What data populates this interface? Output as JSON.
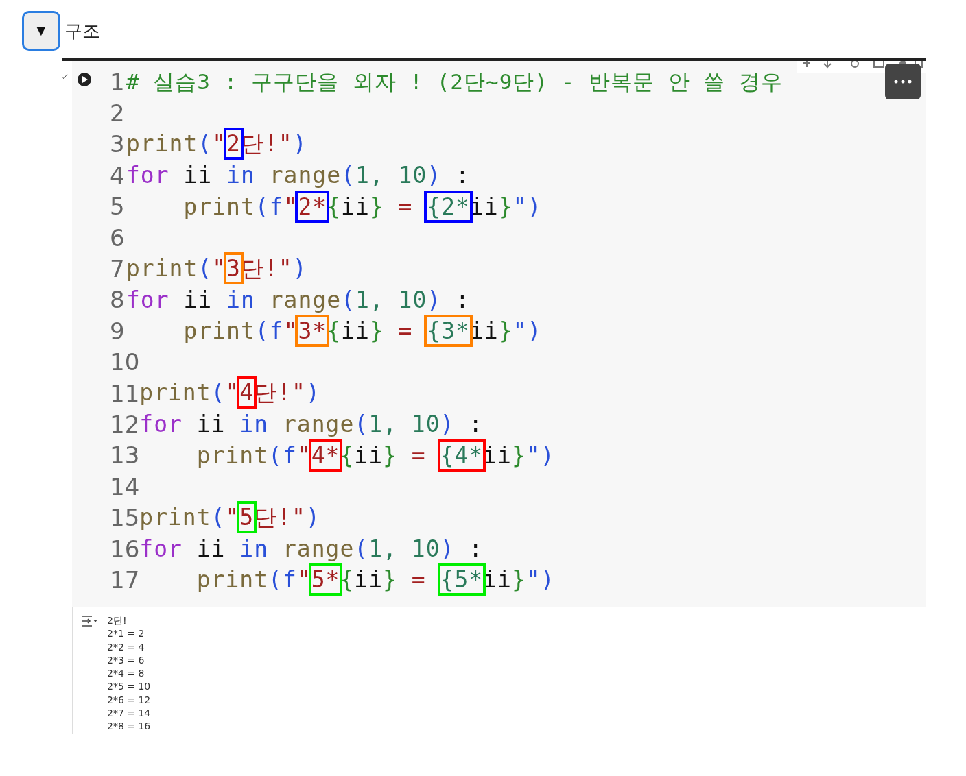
{
  "section": {
    "toggle": "▼",
    "title": "구조"
  },
  "cell": {
    "code_lines": [
      {
        "number": "1",
        "tokens": [
          {
            "text": "# 실습3 : 구구단을 외자 ! (2단~9단) - 반복문 안 쓸 경우",
            "kind": "comment"
          }
        ]
      },
      {
        "number": "2"
      },
      {
        "number": "3",
        "tokens": [
          {
            "text": "print",
            "kind": "fn"
          },
          {
            "text": "(",
            "kind": "paren"
          },
          {
            "text": "\"",
            "kind": "str"
          },
          {
            "text": "2",
            "kind": "str",
            "color": "#0000ff"
          },
          {
            "text": "단!\"",
            "kind": "str"
          },
          {
            "text": ")",
            "kind": "paren"
          }
        ]
      },
      {
        "number": "4",
        "tokens": [
          {
            "text": "for",
            "kind": "kw"
          },
          {
            "text": " ii ",
            "kind": "var"
          },
          {
            "text": "in",
            "kind": "in"
          },
          {
            "text": " range",
            "kind": "fn"
          },
          {
            "text": "(",
            "kind": "paren"
          },
          {
            "text": "1, 10",
            "kind": "num"
          },
          {
            "text": ")",
            "kind": "paren"
          },
          {
            "text": " :",
            "kind": "var"
          }
        ]
      },
      {
        "number": "5",
        "tokens": [
          {
            "text": "    print",
            "kind": "fn"
          },
          {
            "text": "(f",
            "kind": "paren"
          },
          {
            "text": "\"",
            "kind": "str"
          },
          {
            "text": "2*",
            "kind": "str",
            "color": "#0000ff"
          },
          {
            "text": "{",
            "kind": "brace"
          },
          {
            "text": "ii",
            "kind": "var"
          },
          {
            "text": "}",
            "kind": "brace"
          },
          {
            "text": " = ",
            "kind": "str"
          },
          {
            "text": "{2*",
            "kind": "num",
            "color": "#0000ff"
          },
          {
            "text": "ii",
            "kind": "var"
          },
          {
            "text": "}",
            "kind": "brace"
          },
          {
            "text": "\")",
            "kind": "paren"
          }
        ]
      },
      {
        "number": "6"
      },
      {
        "number": "7",
        "tokens": [
          {
            "text": "print",
            "kind": "fn"
          },
          {
            "text": "(",
            "kind": "paren"
          },
          {
            "text": "\"",
            "kind": "str"
          },
          {
            "text": "3",
            "kind": "str",
            "color": "#ff8000"
          },
          {
            "text": "단!\"",
            "kind": "str"
          },
          {
            "text": ")",
            "kind": "paren"
          }
        ]
      },
      {
        "number": "8",
        "tokens": [
          {
            "text": "for",
            "kind": "kw"
          },
          {
            "text": " ii ",
            "kind": "var"
          },
          {
            "text": "in",
            "kind": "in"
          },
          {
            "text": " range",
            "kind": "fn"
          },
          {
            "text": "(",
            "kind": "paren"
          },
          {
            "text": "1, 10",
            "kind": "num"
          },
          {
            "text": ")",
            "kind": "paren"
          },
          {
            "text": " :",
            "kind": "var"
          }
        ]
      },
      {
        "number": "9",
        "tokens": [
          {
            "text": "    print",
            "kind": "fn"
          },
          {
            "text": "(f",
            "kind": "paren"
          },
          {
            "text": "\"",
            "kind": "str"
          },
          {
            "text": "3*",
            "kind": "str",
            "color": "#ff8000"
          },
          {
            "text": "{",
            "kind": "brace"
          },
          {
            "text": "ii",
            "kind": "var"
          },
          {
            "text": "}",
            "kind": "brace"
          },
          {
            "text": " = ",
            "kind": "str"
          },
          {
            "text": "{3*",
            "kind": "num",
            "color": "#ff8000"
          },
          {
            "text": "ii",
            "kind": "var"
          },
          {
            "text": "}",
            "kind": "brace"
          },
          {
            "text": "\")",
            "kind": "paren"
          }
        ]
      },
      {
        "number": "10"
      },
      {
        "number": "11",
        "tokens": [
          {
            "text": "print",
            "kind": "fn"
          },
          {
            "text": "(",
            "kind": "paren"
          },
          {
            "text": "\"",
            "kind": "str"
          },
          {
            "text": "4",
            "kind": "str",
            "color": "#ff0000"
          },
          {
            "text": "단!\"",
            "kind": "str"
          },
          {
            "text": ")",
            "kind": "paren"
          }
        ]
      },
      {
        "number": "12",
        "tokens": [
          {
            "text": "for",
            "kind": "kw"
          },
          {
            "text": " ii ",
            "kind": "var"
          },
          {
            "text": "in",
            "kind": "in"
          },
          {
            "text": " range",
            "kind": "fn"
          },
          {
            "text": "(",
            "kind": "paren"
          },
          {
            "text": "1, 10",
            "kind": "num"
          },
          {
            "text": ")",
            "kind": "paren"
          },
          {
            "text": " :",
            "kind": "var"
          }
        ]
      },
      {
        "number": "13",
        "tokens": [
          {
            "text": "    print",
            "kind": "fn"
          },
          {
            "text": "(f",
            "kind": "paren"
          },
          {
            "text": "\"",
            "kind": "str"
          },
          {
            "text": "4*",
            "kind": "str",
            "color": "#ff0000"
          },
          {
            "text": "{",
            "kind": "brace"
          },
          {
            "text": "ii",
            "kind": "var"
          },
          {
            "text": "}",
            "kind": "brace"
          },
          {
            "text": " = ",
            "kind": "str"
          },
          {
            "text": "{4*",
            "kind": "num",
            "color": "#ff0000"
          },
          {
            "text": "ii",
            "kind": "var"
          },
          {
            "text": "}",
            "kind": "brace"
          },
          {
            "text": "\")",
            "kind": "paren"
          }
        ]
      },
      {
        "number": "14"
      },
      {
        "number": "15",
        "tokens": [
          {
            "text": "print",
            "kind": "fn"
          },
          {
            "text": "(",
            "kind": "paren"
          },
          {
            "text": "\"",
            "kind": "str"
          },
          {
            "text": "5",
            "kind": "str",
            "color": "#00ee00"
          },
          {
            "text": "단!\"",
            "kind": "str"
          },
          {
            "text": ")",
            "kind": "paren"
          }
        ]
      },
      {
        "number": "16",
        "tokens": [
          {
            "text": "for",
            "kind": "kw"
          },
          {
            "text": " ii ",
            "kind": "var"
          },
          {
            "text": "in",
            "kind": "in"
          },
          {
            "text": " range",
            "kind": "fn"
          },
          {
            "text": "(",
            "kind": "paren"
          },
          {
            "text": "1, 10",
            "kind": "num"
          },
          {
            "text": ")",
            "kind": "paren"
          },
          {
            "text": " :",
            "kind": "var"
          }
        ]
      },
      {
        "number": "17",
        "tokens": [
          {
            "text": "    print",
            "kind": "fn"
          },
          {
            "text": "(f",
            "kind": "paren"
          },
          {
            "text": "\"",
            "kind": "str"
          },
          {
            "text": "5*",
            "kind": "str",
            "color": "#00ee00"
          },
          {
            "text": "{",
            "kind": "brace"
          },
          {
            "text": "ii",
            "kind": "var"
          },
          {
            "text": "}",
            "kind": "brace"
          },
          {
            "text": " = ",
            "kind": "str"
          },
          {
            "text": "{5*",
            "kind": "num",
            "color": "#00ee00"
          },
          {
            "text": "ii",
            "kind": "var"
          },
          {
            "text": "}",
            "kind": "brace"
          },
          {
            "text": "\")",
            "kind": "paren"
          }
        ]
      }
    ],
    "output": [
      "2단!",
      "2*1 = 2",
      "2*2 = 4",
      "2*3 = 6",
      "2*4 = 8",
      "2*5 = 10",
      "2*6 = 12",
      "2*7 = 14",
      "2*8 = 16"
    ]
  }
}
